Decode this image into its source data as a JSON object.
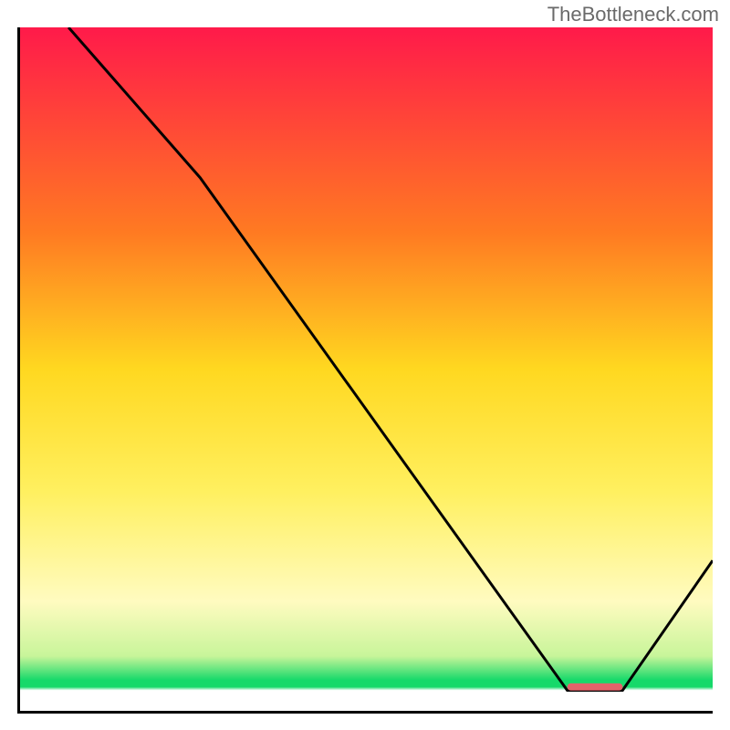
{
  "watermark": "TheBottleneck.com",
  "chart_data": {
    "type": "line",
    "title": "",
    "xlabel": "",
    "ylabel": "",
    "xlim": [
      0,
      100
    ],
    "ylim": [
      0,
      100
    ],
    "gradient_colors": {
      "top": "#ff1a4a",
      "upper_mid": "#ff9a1f",
      "mid": "#ffe020",
      "lower_mid": "#fff880",
      "bottom_band": "#16d96a",
      "background": "#ffffff"
    },
    "gradient_stops": [
      {
        "offset": 0,
        "color": "#ff1a4a"
      },
      {
        "offset": 30,
        "color": "#ff7a22"
      },
      {
        "offset": 50,
        "color": "#ffd820"
      },
      {
        "offset": 68,
        "color": "#fff060"
      },
      {
        "offset": 84,
        "color": "#fffbc0"
      },
      {
        "offset": 92,
        "color": "#c8f59a"
      },
      {
        "offset": 95.5,
        "color": "#16d96a"
      },
      {
        "offset": 96.5,
        "color": "#16d96a"
      },
      {
        "offset": 97,
        "color": "#ffffff"
      },
      {
        "offset": 100,
        "color": "#ffffff"
      }
    ],
    "curve": {
      "x": [
        0.07,
        0.26,
        0.79,
        0.87,
        1.0
      ],
      "y": [
        1.0,
        0.78,
        0.03,
        0.03,
        0.22
      ]
    },
    "marker": {
      "x_start": 0.79,
      "x_end": 0.87,
      "y": 0.035,
      "color": "#e1636a"
    }
  }
}
